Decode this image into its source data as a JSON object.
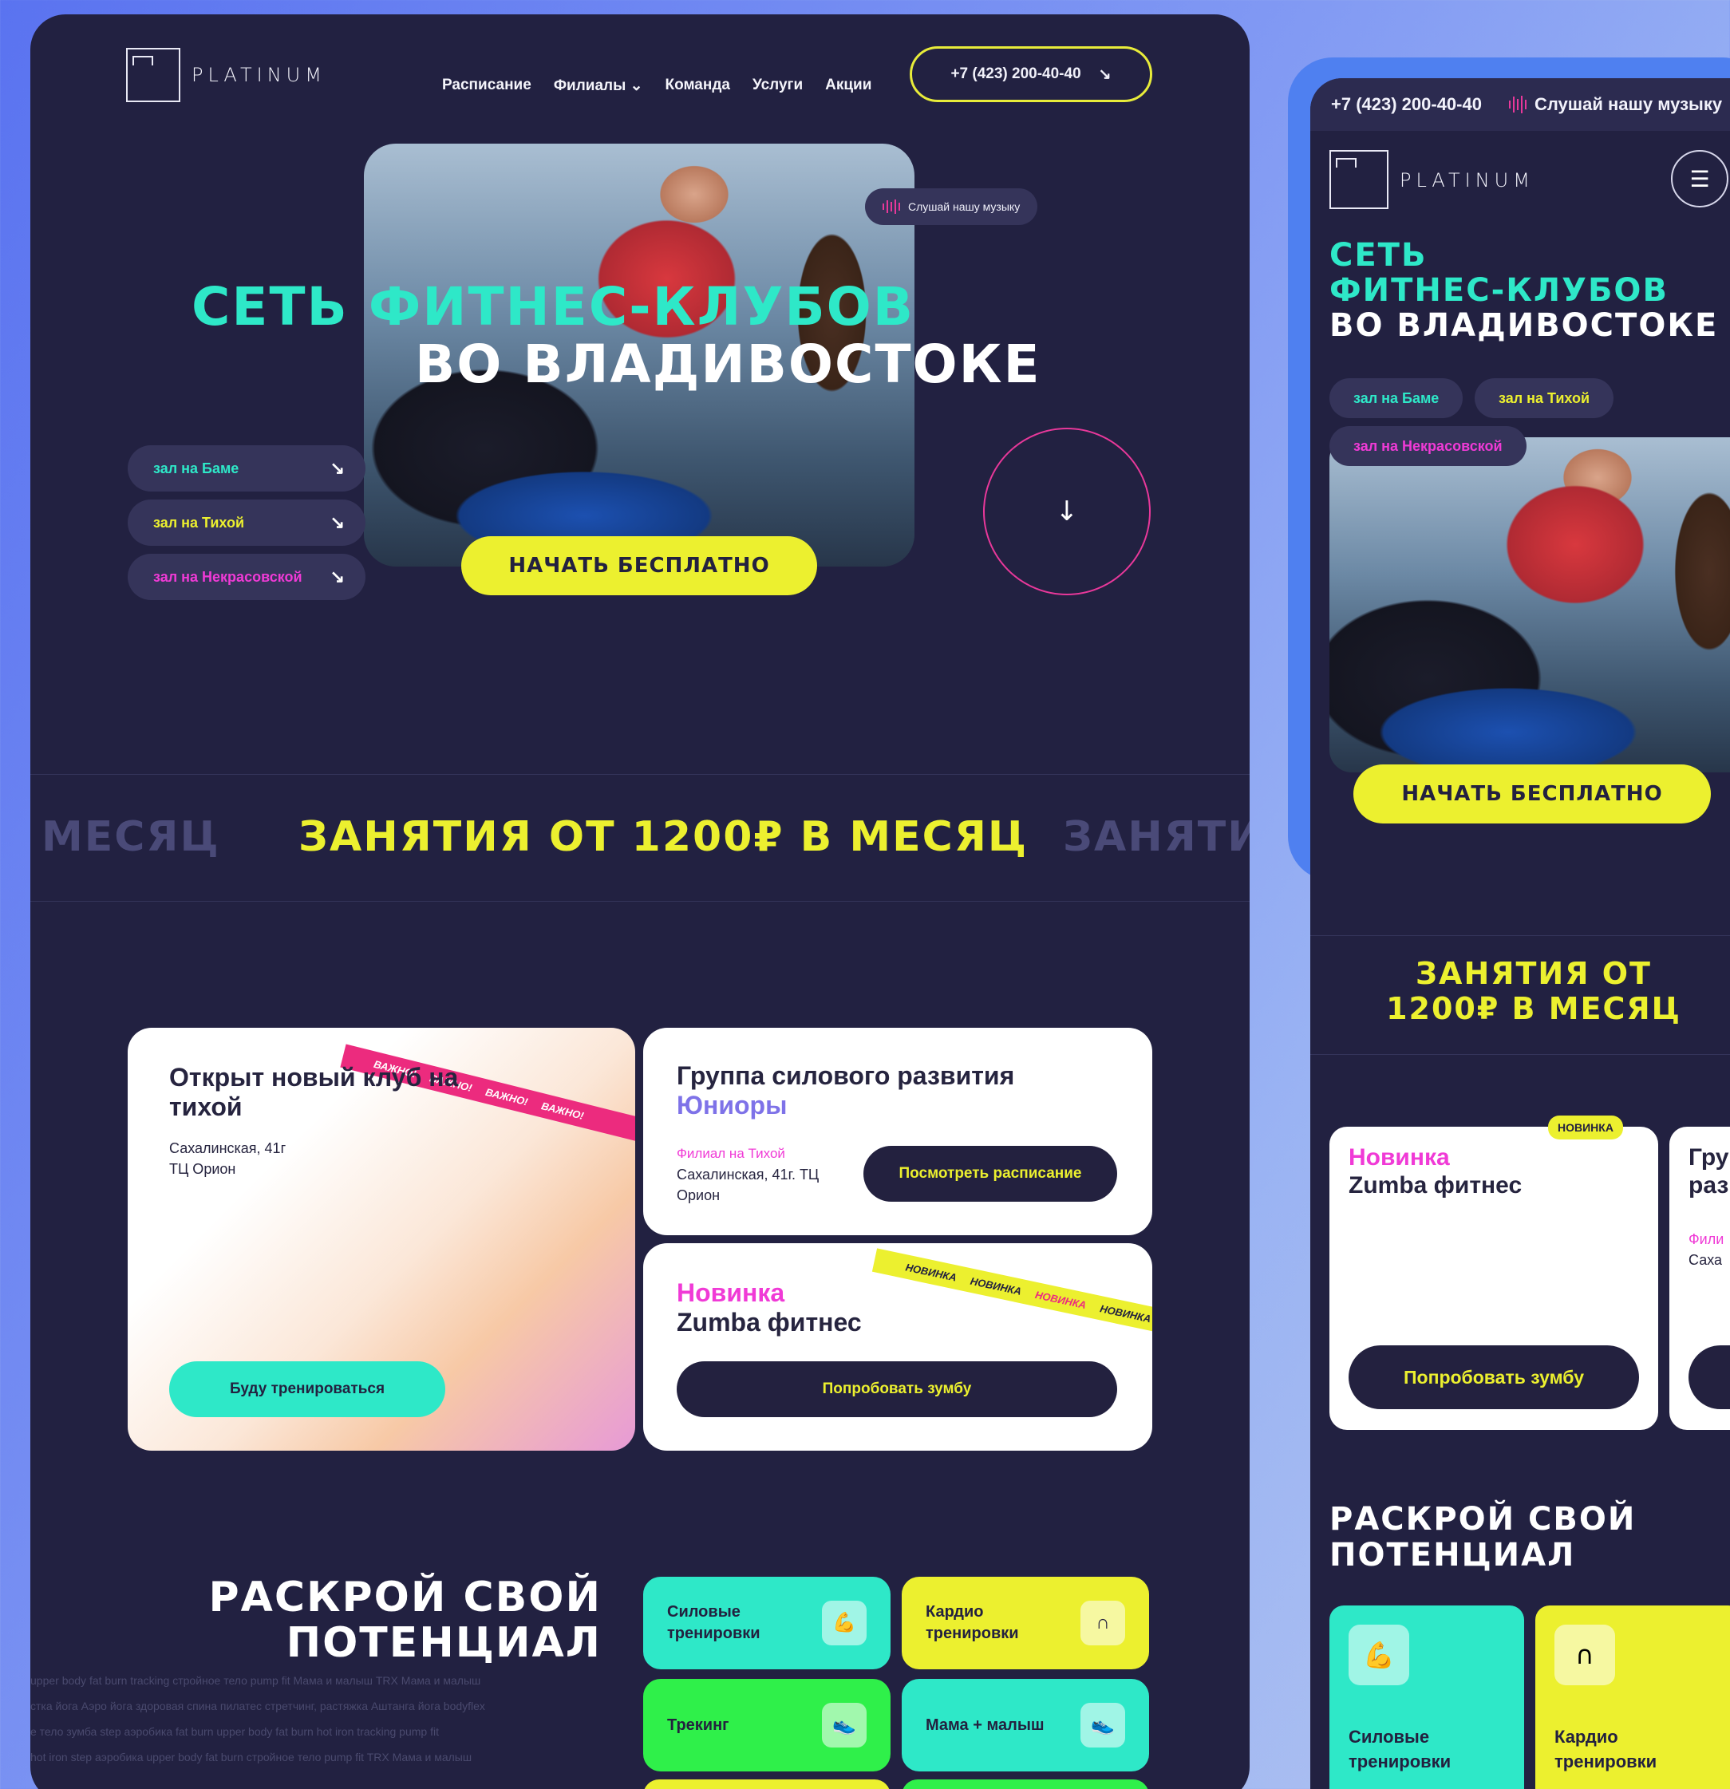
{
  "desktop": {
    "logo_text": "PLATINUM",
    "nav": [
      "Расписание",
      "Филиалы",
      "Команда",
      "Услуги",
      "Акции"
    ],
    "nav_dropdown_caret": "⌄",
    "phone": "+7 (423) 200-40-40",
    "music": "Слушай нашу музыку",
    "hero_line1": "СЕТЬ ФИТНЕС-КЛУБОВ",
    "hero_line2": "ВО ВЛАДИВОСТОКЕ",
    "clubs": [
      {
        "label": "зал на Баме",
        "color": "#2ee8c8"
      },
      {
        "label": "зал на Тихой",
        "color": "#ecf02f"
      },
      {
        "label": "зал на Некрасовской",
        "color": "#f03ad6"
      }
    ],
    "start": "НАЧАТЬ БЕСПЛАТНО",
    "ticker": [
      "МЕСЯЦ",
      "ЗАНЯТИЯ ОТ 1200₽ В МЕСЯЦ",
      "ЗАНЯТИ"
    ],
    "card1": {
      "ribbon": "ВАЖНО!",
      "title": "Открыт новый клуб на тихой",
      "address": "Сахалинская, 41г",
      "place": "ТЦ Орион",
      "button": "Буду тренироваться"
    },
    "card2": {
      "title": "Группа силового развития",
      "accent": "Юниоры",
      "branch": "Филиал на Тихой",
      "address": "Сахалинская, 41г. ТЦ Орион",
      "button": "Посмотреть расписание"
    },
    "card3": {
      "ribbon": "НОВИНКА",
      "accent": "Новинка",
      "title": "Zumba фитнес",
      "button": "Попробовать зумбу"
    },
    "potential": [
      "РАСКРОЙ СВОЙ",
      "ПОТЕНЦИАЛ"
    ],
    "tiles": [
      {
        "label": "Силовые тренировки",
        "color": "#2ee8c8"
      },
      {
        "label": "Кардио тренировки",
        "color": "#ecf02f"
      },
      {
        "label": "Трекинг",
        "color": "#2ff04a"
      },
      {
        "label": "Мама + малыш",
        "color": "#2ee8c8"
      }
    ],
    "tag_rows": [
      "upper body  fat burn  tracking  стройное тело  pump fit  Мама и малыш  TRX  Мама и малыш",
      "стка йога  Аэро йога  здоровая спина  пилатес  стретчинг, растяжка  Аштанга йога  bodyflex",
      "е тело  зумба  step аэробика  fat burn  upper body  fat burn  hot iron  tracking  pump fit",
      "hot iron  step аэробика  upper body  fat burn  стройное тело  pump fit  TRX  Мама и малыш"
    ]
  },
  "mobile": {
    "phone": "+7 (423) 200-40-40",
    "music": "Слушай нашу музыку",
    "logo_text": "PLATINUM",
    "title": [
      "СЕТЬ",
      "ФИТНЕС-КЛУБОВ",
      "ВО ВЛАДИВОСТОКЕ"
    ],
    "pills": [
      "зал на Баме",
      "зал на Тихой",
      "зал на Некрасовской"
    ],
    "start": "НАЧАТЬ БЕСПЛАТНО",
    "price": [
      "ЗАНЯТИЯ ОТ",
      "1200₽ В МЕСЯЦ"
    ],
    "badge": "НОВИНКА",
    "card_accent": "Новинка",
    "card_title": "Zumba фитнес",
    "card_button": "Попробовать зумбу",
    "card2_title": "Гру раз",
    "card2_branch": "Фили",
    "card2_address": "Саха",
    "potential": [
      "РАСКРОЙ СВОЙ",
      "ПОТЕНЦИАЛ"
    ],
    "tiles": [
      "Силовые тренировки",
      "Кардио тренировки"
    ]
  },
  "colors": {
    "bg": "#222141",
    "teal": "#2ee8c8",
    "yellow": "#ecf02f",
    "pink": "#e8389a",
    "magenta": "#f03ad6"
  }
}
